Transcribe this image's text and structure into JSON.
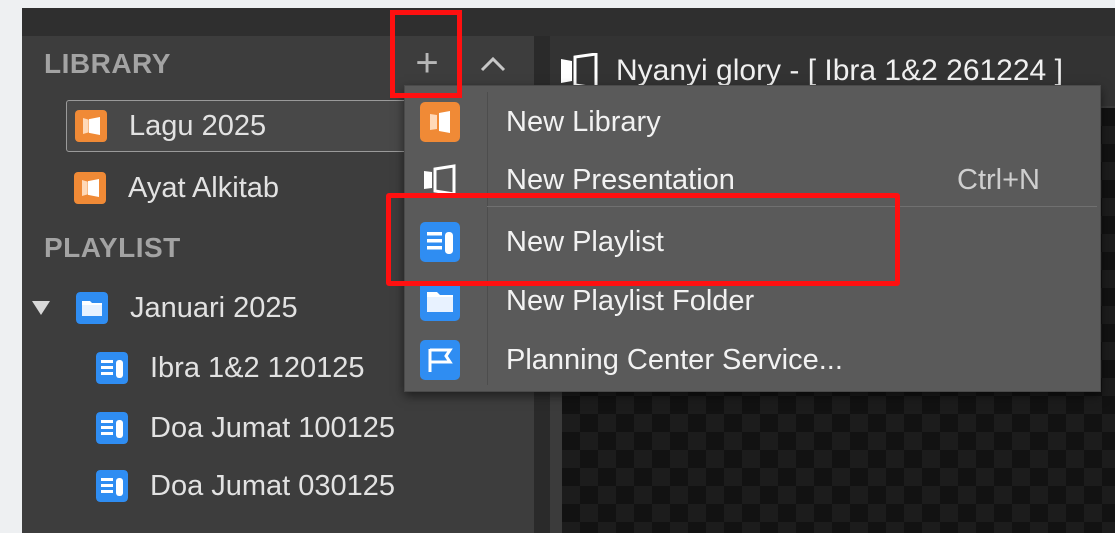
{
  "header": {
    "title": "Nyanyi glory - [ Ibra 1&2 261224 ]"
  },
  "sidebar": {
    "library_title": "LIBRARY",
    "add_symbol": "+",
    "libraries": [
      {
        "label": "Lagu 2025",
        "selected": true
      },
      {
        "label": "Ayat Alkitab",
        "selected": false
      }
    ],
    "playlist_title": "PLAYLIST",
    "folder": {
      "label": "Januari 2025",
      "expanded": true
    },
    "playlists": [
      {
        "label": "Ibra 1&2 120125"
      },
      {
        "label": "Doa Jumat 100125"
      },
      {
        "label": "Doa Jumat 030125"
      }
    ]
  },
  "menu": {
    "items": [
      {
        "label": "New Library",
        "shortcut": "",
        "icon": "library-icon"
      },
      {
        "label": "New Presentation",
        "shortcut": "Ctrl+N",
        "icon": "presentation-icon"
      },
      {
        "label": "New Playlist",
        "shortcut": "",
        "icon": "playlist-icon"
      },
      {
        "label": "New Playlist Folder",
        "shortcut": "",
        "icon": "folder-icon"
      },
      {
        "label": "Planning Center Service...",
        "shortcut": "",
        "icon": "planning-center-icon"
      }
    ]
  },
  "colors": {
    "library_orange": "#f08a36",
    "playlist_blue": "#2f8df2",
    "highlight_red": "#ff1010",
    "panel": "#3d3d3d",
    "menu": "#5a5a5a"
  }
}
